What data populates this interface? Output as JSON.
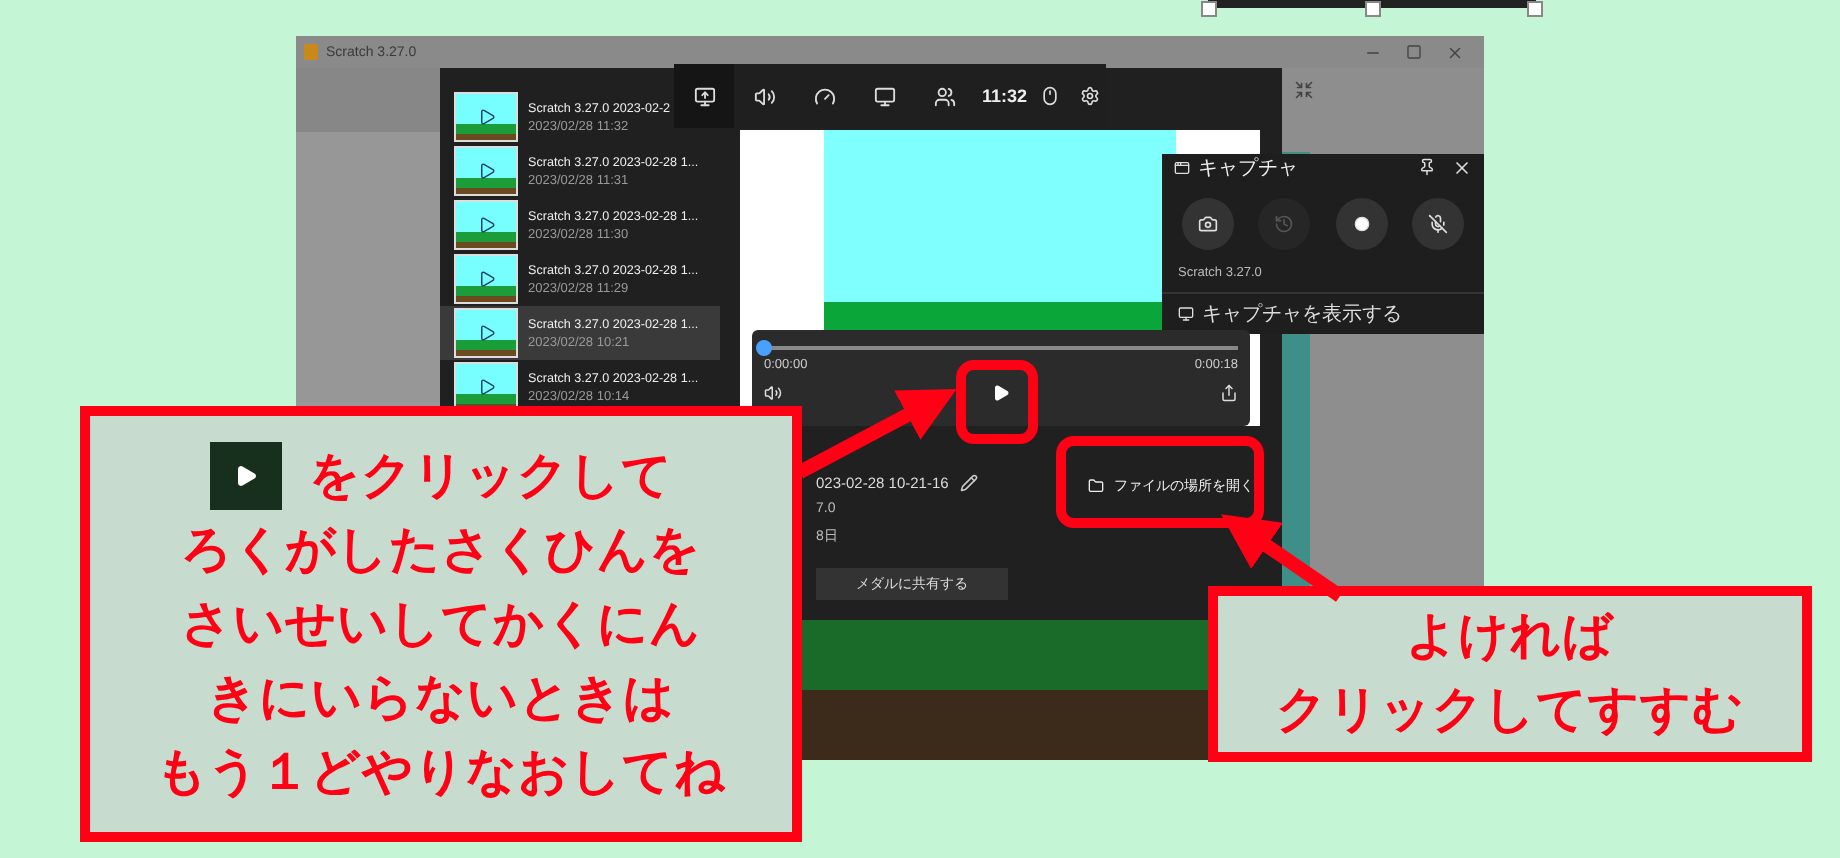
{
  "scratch_window": {
    "title": "Scratch 3.27.0"
  },
  "gallery": {
    "items": [
      {
        "title": "Scratch 3.27.0 2023-02-2",
        "date": "2023/02/28 11:32",
        "selected": false
      },
      {
        "title": "Scratch 3.27.0 2023-02-28 1...",
        "date": "2023/02/28 11:31",
        "selected": false
      },
      {
        "title": "Scratch 3.27.0 2023-02-28 1...",
        "date": "2023/02/28 11:30",
        "selected": false
      },
      {
        "title": "Scratch 3.27.0 2023-02-28 1...",
        "date": "2023/02/28 11:29",
        "selected": false
      },
      {
        "title": "Scratch 3.27.0 2023-02-28 1...",
        "date": "2023/02/28 10:21",
        "selected": true
      },
      {
        "title": "Scratch 3.27.0 2023-02-28 1...",
        "date": "2023/02/28 10:14",
        "selected": false
      }
    ]
  },
  "game_bar": {
    "time": "11:32"
  },
  "capture_widget": {
    "title": "キャプチャ",
    "app": "Scratch 3.27.0",
    "link": "キャプチャを表示する"
  },
  "player": {
    "elapsed": "0:00:00",
    "duration": "0:00:18",
    "level": 0
  },
  "details": {
    "name": "023-02-28 10-21-16",
    "app": "7.0",
    "date": "8日",
    "share_button": "メダルに共有する",
    "open_location": "ファイルの場所を開く"
  },
  "callouts": [
    {
      "lines": [
        "をクリックして",
        "ろくがしたさくひんを",
        "さいせいしてかくにん",
        "きにいらないときは",
        "もう１どやりなおしてね"
      ]
    },
    {
      "lines": [
        "よければ",
        "クリックしてすすむ"
      ]
    }
  ]
}
